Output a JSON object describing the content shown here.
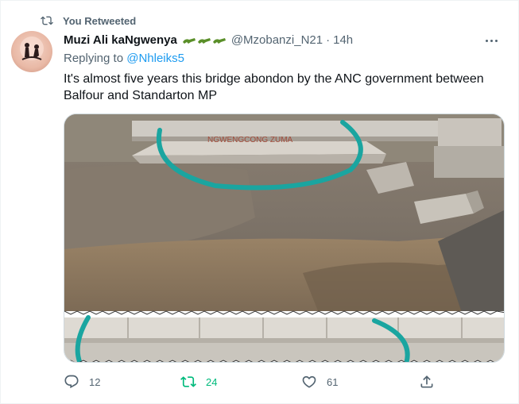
{
  "retweet_banner": "You Retweeted",
  "author": {
    "name": "Muzi Ali kaNgwenya",
    "handle": "@Mzobanzi_N21",
    "separator": "·",
    "time": "14h"
  },
  "reply": {
    "prefix": "Replying to ",
    "to": "@Nhleiks5"
  },
  "tweet_text": "It's almost five years this bridge abondon by the ANC government between Balfour and Standarton MP",
  "media": {
    "graffiti": "NGWENGCONG ZUMA"
  },
  "actions": {
    "replies": "12",
    "retweets": "24",
    "likes": "61"
  },
  "colors": {
    "accent": "#1d9bf0",
    "retweet_active": "#00ba7c",
    "muted": "#536471"
  }
}
